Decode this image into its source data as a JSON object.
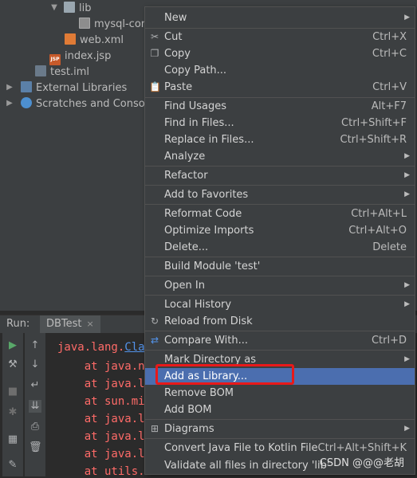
{
  "project_tree": {
    "lib_folder": "lib",
    "mysql_jar": "mysql-conn",
    "web_xml": "web.xml",
    "index_jsp": "index.jsp",
    "jsp_badge": "JSP",
    "test_iml": "test.iml",
    "external_libraries": "External Libraries",
    "scratches": "Scratches and Consoles"
  },
  "run_panel": {
    "label": "Run:",
    "tab": "DBTest",
    "close": "×"
  },
  "console": {
    "lines": [
      "java.lang.Clas",
      "    at java.ne",
      "    at java.la",
      "    at sun.mis",
      "    at java.la",
      "    at java.la",
      "    at java.la",
      "    at utils.D"
    ],
    "link_text": "Clas"
  },
  "context_menu": {
    "items": [
      {
        "label": "New",
        "submenu": true
      },
      {
        "label": "Cut",
        "shortcut": "Ctrl+X",
        "icon": "scissors"
      },
      {
        "label": "Copy",
        "shortcut": "Ctrl+C",
        "icon": "copy"
      },
      {
        "label": "Copy Path...",
        "shortcut": ""
      },
      {
        "label": "Paste",
        "shortcut": "Ctrl+V",
        "icon": "clipboard"
      },
      {
        "label": "Find Usages",
        "shortcut": "Alt+F7"
      },
      {
        "label": "Find in Files...",
        "shortcut": "Ctrl+Shift+F"
      },
      {
        "label": "Replace in Files...",
        "shortcut": "Ctrl+Shift+R"
      },
      {
        "label": "Analyze",
        "submenu": true
      },
      {
        "label": "Refactor",
        "submenu": true
      },
      {
        "label": "Add to Favorites",
        "submenu": true
      },
      {
        "label": "Reformat Code",
        "shortcut": "Ctrl+Alt+L"
      },
      {
        "label": "Optimize Imports",
        "shortcut": "Ctrl+Alt+O"
      },
      {
        "label": "Delete...",
        "shortcut": "Delete"
      },
      {
        "label": "Build Module 'test'"
      },
      {
        "label": "Open In",
        "submenu": true
      },
      {
        "label": "Local History",
        "submenu": true
      },
      {
        "label": "Reload from Disk",
        "icon": "reload"
      },
      {
        "label": "Compare With...",
        "shortcut": "Ctrl+D",
        "icon": "compare"
      },
      {
        "label": "Mark Directory as",
        "submenu": true
      },
      {
        "label": "Add as Library...",
        "selected": true
      },
      {
        "label": "Remove BOM"
      },
      {
        "label": "Add BOM"
      },
      {
        "label": "Diagrams",
        "submenu": true,
        "icon": "diagram"
      },
      {
        "label": "Convert Java File to Kotlin File",
        "shortcut": "Ctrl+Alt+Shift+K"
      },
      {
        "label": "Validate all files in directory 'lib'"
      }
    ],
    "submenu_arrow": "▶"
  },
  "watermark": "CSDN @@@老胡",
  "colors": {
    "menu_bg": "#3c3f41",
    "selection": "#4b6eaf",
    "highlight_box": "#e8191a",
    "error_text": "#ff6b68"
  }
}
